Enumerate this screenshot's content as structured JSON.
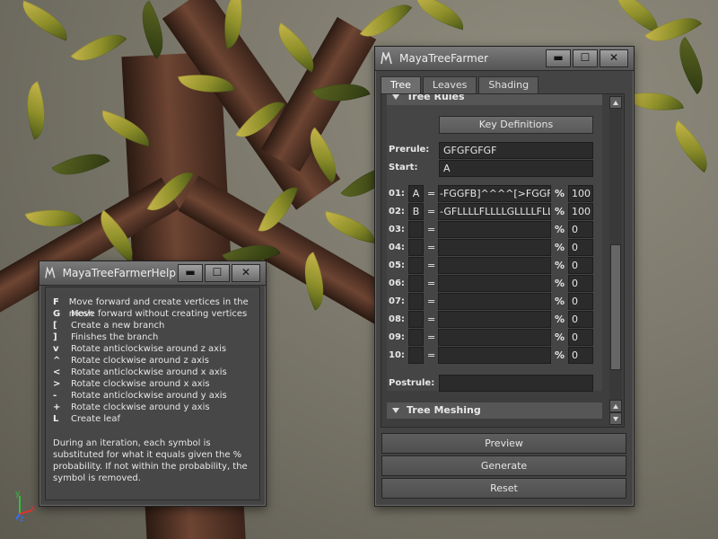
{
  "help_window": {
    "title": "MayaTreeFarmerHelp",
    "keys": [
      {
        "key": "F",
        "desc": "Move forward and create vertices in the mesh"
      },
      {
        "key": "G",
        "desc": "Move forward without creating vertices"
      },
      {
        "key": "[",
        "desc": "Create a new branch"
      },
      {
        "key": "]",
        "desc": "Finishes the branch"
      },
      {
        "key": "v",
        "desc": "Rotate anticlockwise around z axis"
      },
      {
        "key": "^",
        "desc": "Rotate clockwise around z axis"
      },
      {
        "key": "<",
        "desc": "Rotate anticlockwise around x axis"
      },
      {
        "key": ">",
        "desc": "Rotate clockwise around x axis"
      },
      {
        "key": "-",
        "desc": "Rotate anticlockwise around y axis"
      },
      {
        "key": "+",
        "desc": "Rotate clockwise around y axis"
      },
      {
        "key": "L",
        "desc": "Create leaf"
      }
    ],
    "note": "During an iteration, each symbol is substituted for what it equals given the % probability. If not within the probability, the symbol is removed.",
    "buttons": {
      "minimize": "▬",
      "maximize": "☐",
      "close": "✕"
    }
  },
  "main_window": {
    "title": "MayaTreeFarmer",
    "buttons": {
      "minimize": "▬",
      "maximize": "☐",
      "close": "✕"
    },
    "tabs": [
      "Tree",
      "Leaves",
      "Shading"
    ],
    "active_tab": "Tree",
    "tree_rules": {
      "header": "Tree Rules",
      "key_definitions": "Key Definitions",
      "prerule_label": "Prerule:",
      "prerule": "GFGFGFGF",
      "start_label": "Start:",
      "start": "A",
      "equals": "=",
      "percent": "%",
      "rules": [
        {
          "n": "01:",
          "sym": "A",
          "rule": "-FGGFB]^^^^[>FGGFB]",
          "prob": "100"
        },
        {
          "n": "02:",
          "sym": "B",
          "rule": "-GFLLLLFLLLLGLLLLFLLLB]",
          "prob": "100"
        },
        {
          "n": "03:",
          "sym": "",
          "rule": "",
          "prob": "0"
        },
        {
          "n": "04:",
          "sym": "",
          "rule": "",
          "prob": "0"
        },
        {
          "n": "05:",
          "sym": "",
          "rule": "",
          "prob": "0"
        },
        {
          "n": "06:",
          "sym": "",
          "rule": "",
          "prob": "0"
        },
        {
          "n": "07:",
          "sym": "",
          "rule": "",
          "prob": "0"
        },
        {
          "n": "08:",
          "sym": "",
          "rule": "",
          "prob": "0"
        },
        {
          "n": "09:",
          "sym": "",
          "rule": "",
          "prob": "0"
        },
        {
          "n": "10:",
          "sym": "",
          "rule": "",
          "prob": "0"
        }
      ],
      "postrule_label": "Postrule:",
      "postrule": ""
    },
    "tree_meshing": {
      "header": "Tree Meshing"
    },
    "actions": {
      "preview": "Preview",
      "generate": "Generate",
      "reset": "Reset"
    }
  },
  "viewport": {
    "axes": {
      "x": "x",
      "y": "y",
      "z": "z"
    },
    "colors": {
      "x": "#e03030",
      "y": "#30c040",
      "z": "#3070ff"
    }
  }
}
